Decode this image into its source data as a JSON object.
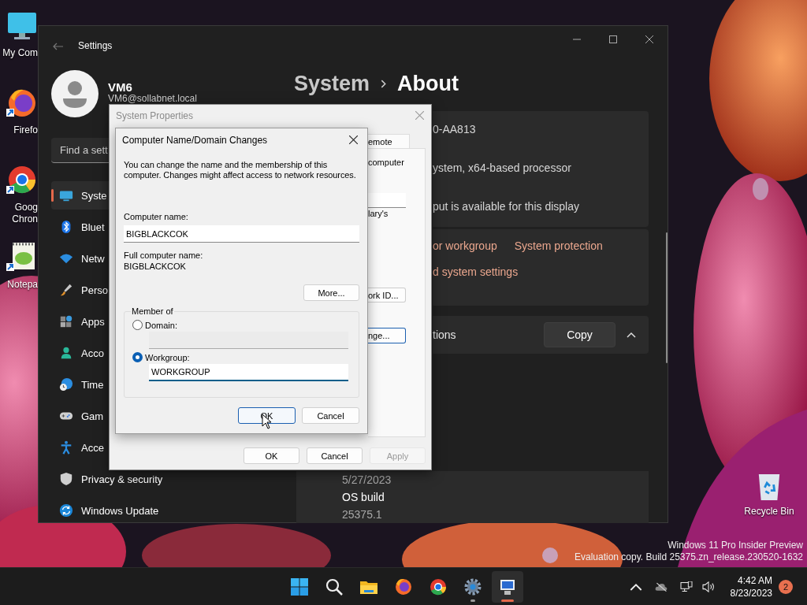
{
  "desktop_shortcuts": [
    {
      "kind": "computer",
      "label_lines": [
        "My Com"
      ]
    },
    {
      "kind": "firefox",
      "label_lines": [
        "Firefo"
      ]
    },
    {
      "kind": "chrome",
      "label_lines": [
        "Goog",
        "Chron"
      ]
    },
    {
      "kind": "notepad",
      "label_lines": [
        "Notepa"
      ]
    }
  ],
  "recycle_bin": {
    "label": "Recycle Bin"
  },
  "evaluation_notice": [
    "Windows 11 Pro Insider Preview",
    "Evaluation copy. Build 25375.zn_release.230520-1632"
  ],
  "settings_window": {
    "title": "Settings",
    "user": {
      "name": "VM6",
      "email": "VM6@sollabnet.local"
    },
    "search": {
      "placeholder": "Find a sett"
    },
    "nav": [
      {
        "label": "Syste",
        "kind": "system",
        "selected": true
      },
      {
        "label": "Bluet",
        "kind": "bluetooth",
        "selected": false
      },
      {
        "label": "Netw",
        "kind": "network",
        "selected": false
      },
      {
        "label": "Perso",
        "kind": "brush",
        "selected": false
      },
      {
        "label": "Apps",
        "kind": "apps",
        "selected": false
      },
      {
        "label": "Acco",
        "kind": "accounts",
        "selected": false
      },
      {
        "label": "Time",
        "kind": "time",
        "selected": false
      },
      {
        "label": "Gam",
        "kind": "gaming",
        "selected": false
      },
      {
        "label": "Acce",
        "kind": "accessibility",
        "selected": false
      },
      {
        "label": "Privacy & security",
        "kind": "privacy",
        "selected": false
      },
      {
        "label": "Windows Update",
        "kind": "update",
        "selected": false
      }
    ],
    "breadcrumb": {
      "parent": "System",
      "current": "About"
    },
    "device_rows": [
      "0-AA813",
      "ystem, x64-based processor",
      "put is available for this display"
    ],
    "link_rows": [
      [
        "or workgroup",
        "System protection"
      ],
      [
        "d system settings"
      ]
    ],
    "related": {
      "label": "tions",
      "button": "Copy",
      "expanded": true
    },
    "windows_spec": [
      {
        "text": "5/27/2023",
        "kind": "value"
      },
      {
        "text": "OS build",
        "kind": "label"
      },
      {
        "text": "25375.1",
        "kind": "value"
      }
    ]
  },
  "system_properties": {
    "title": "System Properties",
    "tab": "emote",
    "texts": [
      "computer",
      "lary's"
    ],
    "buttons": [
      {
        "label": "ork ID...",
        "focused": false
      },
      {
        "label": "nge...",
        "focused": true
      }
    ],
    "footer_buttons": [
      {
        "label": "OK",
        "disabled": false
      },
      {
        "label": "Cancel",
        "disabled": false
      },
      {
        "label": "Apply",
        "disabled": true
      }
    ]
  },
  "name_dialog": {
    "title": "Computer Name/Domain Changes",
    "description": "You can change the name and the membership of this computer. Changes might affect access to network resources.",
    "computer_name": {
      "label": "Computer name:",
      "value": "BIGBLACKCOK"
    },
    "full_name": {
      "label": "Full computer name:",
      "value": "BIGBLACKCOK"
    },
    "more_button": "More...",
    "member_of": {
      "label": "Member of",
      "options": [
        {
          "label": "Domain:",
          "selected": false,
          "field": {
            "disabled": true,
            "focused": false
          }
        },
        {
          "label": "Workgroup:",
          "selected": true,
          "field": {
            "value": "WORKGROUP",
            "disabled": false,
            "focused": true
          }
        }
      ]
    },
    "buttons": [
      {
        "label": "OK",
        "focused": true
      },
      {
        "label": "Cancel",
        "focused": false
      }
    ]
  },
  "taskbar": {
    "apps": [
      {
        "kind": "start",
        "running": false,
        "active": false
      },
      {
        "kind": "search",
        "running": false,
        "active": false
      },
      {
        "kind": "explorer",
        "running": false,
        "active": false
      },
      {
        "kind": "firefox",
        "running": false,
        "active": false
      },
      {
        "kind": "chrome",
        "running": false,
        "active": false
      },
      {
        "kind": "settings",
        "running": true,
        "active": false
      },
      {
        "kind": "system",
        "running": true,
        "active": true
      }
    ],
    "clock": {
      "time": "4:42 AM",
      "date": "8/23/2023"
    },
    "notification_count": "2"
  }
}
